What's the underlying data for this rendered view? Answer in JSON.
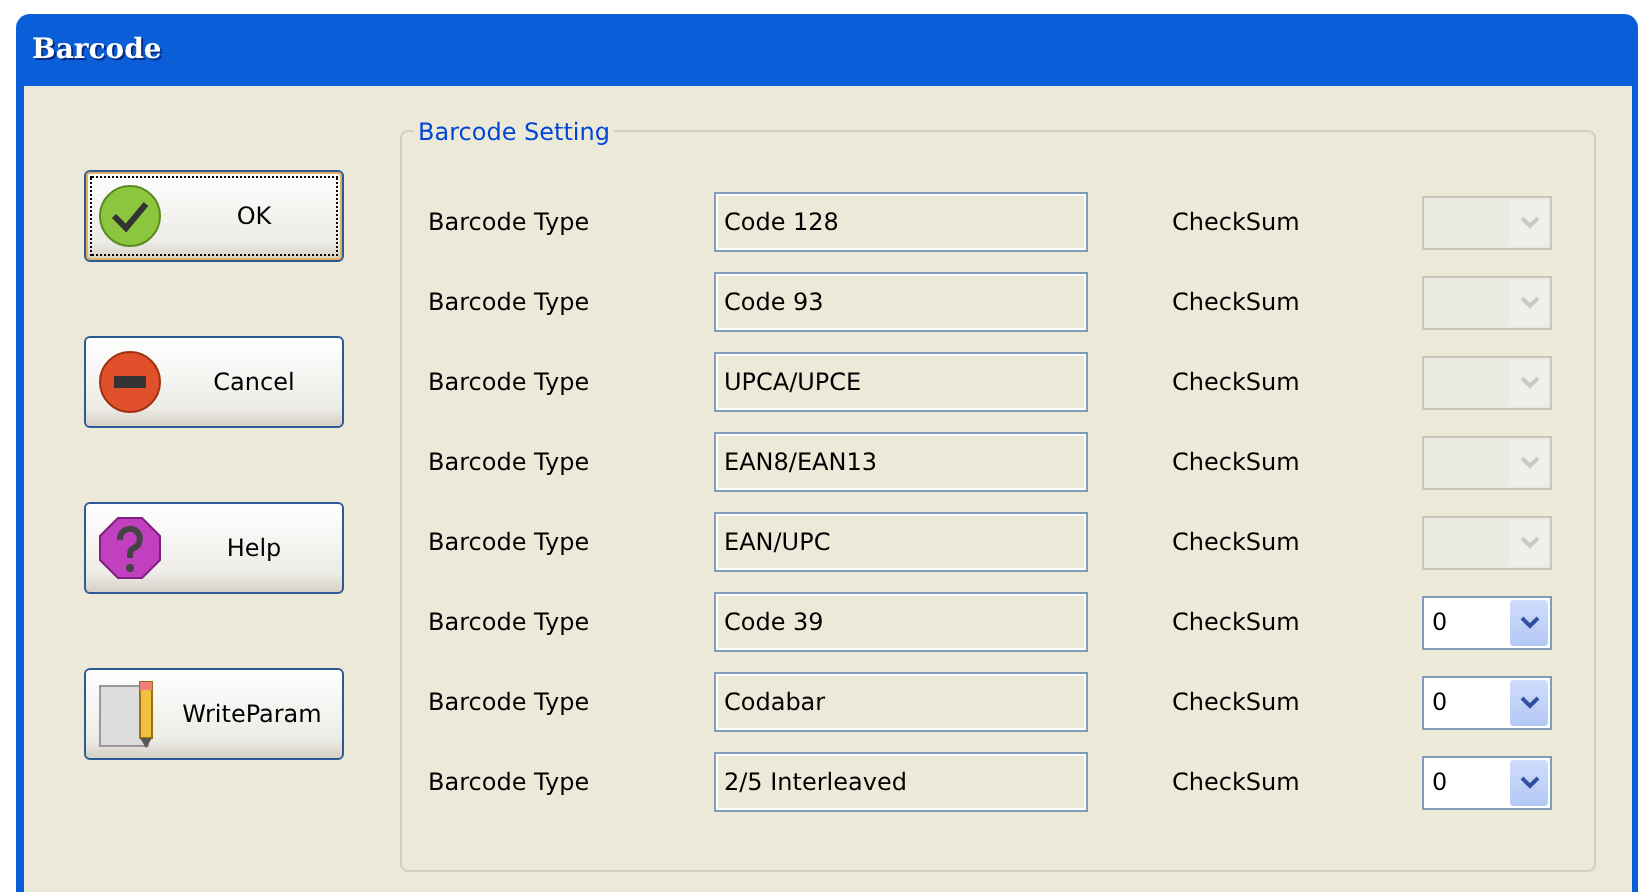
{
  "window": {
    "title": "Barcode"
  },
  "buttons": [
    {
      "label": "OK",
      "kind": "ok",
      "focused": true
    },
    {
      "label": "Cancel",
      "kind": "cancel",
      "focused": false
    },
    {
      "label": "Help",
      "kind": "help",
      "focused": false
    },
    {
      "label": "WriteParam",
      "kind": "write",
      "focused": false
    }
  ],
  "group": {
    "title": "Barcode Setting",
    "rows": [
      {
        "label": "Barcode Type",
        "value": "Code 128",
        "checksum_label": "CheckSum",
        "checksum": {
          "disabled": true
        }
      },
      {
        "label": "Barcode Type",
        "value": "Code 93",
        "checksum_label": "CheckSum",
        "checksum": {
          "disabled": true
        }
      },
      {
        "label": "Barcode Type",
        "value": "UPCA/UPCE",
        "checksum_label": "CheckSum",
        "checksum": {
          "disabled": true
        }
      },
      {
        "label": "Barcode Type",
        "value": "EAN8/EAN13",
        "checksum_label": "CheckSum",
        "checksum": {
          "disabled": true
        }
      },
      {
        "label": "Barcode Type",
        "value": "EAN/UPC",
        "checksum_label": "CheckSum",
        "checksum": {
          "disabled": true
        }
      },
      {
        "label": "Barcode Type",
        "value": "Code 39",
        "checksum_label": "CheckSum",
        "checksum": {
          "disabled": false,
          "value": "0"
        }
      },
      {
        "label": "Barcode Type",
        "value": "Codabar",
        "checksum_label": "CheckSum",
        "checksum": {
          "disabled": false,
          "value": "0"
        }
      },
      {
        "label": "Barcode Type",
        "value": "2/5 Interleaved",
        "checksum_label": "CheckSum",
        "checksum": {
          "disabled": false,
          "value": "0"
        }
      }
    ]
  }
}
